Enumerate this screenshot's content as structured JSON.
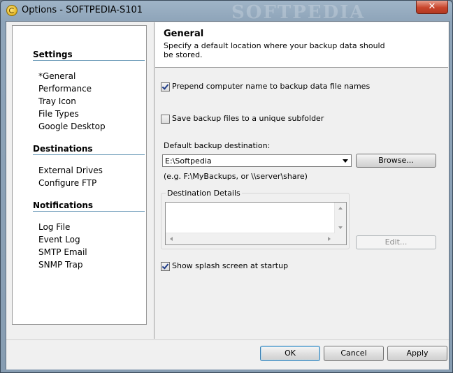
{
  "window": {
    "title": "Options - SOFTPEDIA-S101",
    "close_glyph": "✕",
    "watermark": "SOFTPEDIA"
  },
  "sidebar": {
    "sections": [
      {
        "title": "Settings",
        "items": [
          "*General",
          "Performance",
          "Tray Icon",
          "File Types",
          "Google Desktop"
        ]
      },
      {
        "title": "Destinations",
        "items": [
          "External Drives",
          "Configure FTP"
        ]
      },
      {
        "title": "Notifications",
        "items": [
          "Log File",
          "Event Log",
          "SMTP Email",
          "SNMP Trap"
        ]
      }
    ]
  },
  "header": {
    "title": "General",
    "description": "Specify a default location where your backup data should be stored."
  },
  "options": {
    "prepend_label": "Prepend computer name to backup data file names",
    "prepend_checked": true,
    "subfolder_label": "Save backup files to a unique subfolder",
    "subfolder_checked": false,
    "default_dest_label": "Default backup destination:",
    "default_dest_value": "E:\\Softpedia",
    "browse_label": "Browse...",
    "example_hint": "(e.g. F:\\MyBackups, or \\\\server\\share)",
    "dest_details_label": "Destination Details",
    "edit_label": "Edit...",
    "splash_label": "Show splash screen at startup",
    "splash_checked": true
  },
  "footer": {
    "ok_label": "OK",
    "cancel_label": "Cancel",
    "apply_label": "Apply"
  },
  "icons": {
    "app": "app-icon",
    "close": "close-icon",
    "dropdown": "chevron-down-icon"
  }
}
